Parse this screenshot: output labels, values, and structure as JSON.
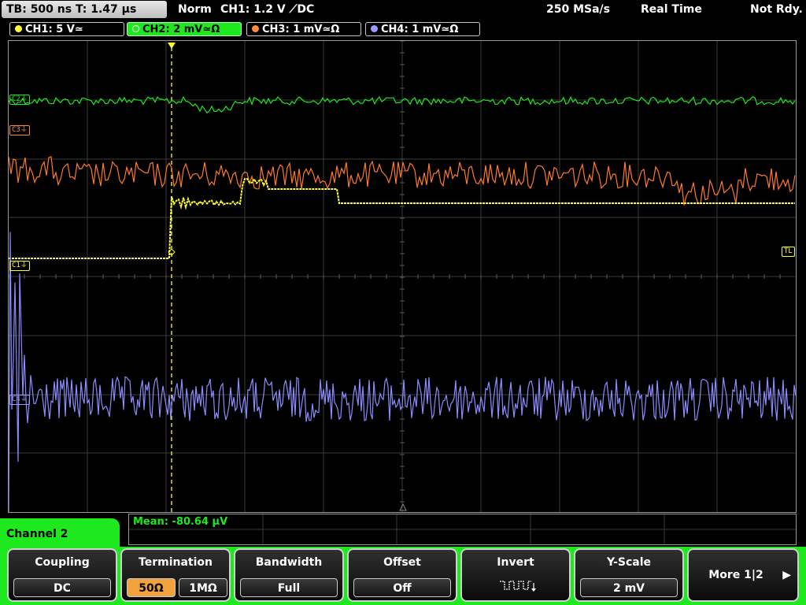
{
  "topbar": {
    "timebase": "TB: 500 ns   T: 1.47 µs",
    "mode": "Norm",
    "trigger": "CH1: 1.2 V ⟋DC",
    "sample_rate": "250 MSa/s",
    "acq_mode": "Real Time",
    "status": "Not Rdy."
  },
  "channels": [
    {
      "label": "CH1: 5 V≃",
      "color": "#ffff33"
    },
    {
      "label": "CH2: 2 mV≃Ω",
      "color": "#1ee81e"
    },
    {
      "label": "CH3: 1 mV≃Ω",
      "color": "#ff8c3a"
    },
    {
      "label": "CH4: 1 mV≃Ω",
      "color": "#9a9aff"
    }
  ],
  "markers": {
    "c1": "C1⏚",
    "c2": "C2⏚",
    "c3": "C3⏚",
    "c4": "C4⏚",
    "tl": "TL",
    "trig": "T"
  },
  "measurement": {
    "mean": "Mean: -80.64 µV"
  },
  "menu": {
    "channel": "Channel 2",
    "coupling": {
      "title": "Coupling",
      "value": "DC"
    },
    "termination": {
      "title": "Termination",
      "selected": "50Ω",
      "other": "1MΩ"
    },
    "bandwidth": {
      "title": "Bandwidth",
      "value": "Full"
    },
    "offset": {
      "title": "Offset",
      "value": "Off"
    },
    "invert": {
      "title": "Invert",
      "icon": "invert-waveform-icon"
    },
    "yscale": {
      "title": "Y-Scale",
      "value": "2 mV"
    },
    "more": {
      "title": "More 1|2",
      "icon": "play-arrow-icon"
    }
  }
}
